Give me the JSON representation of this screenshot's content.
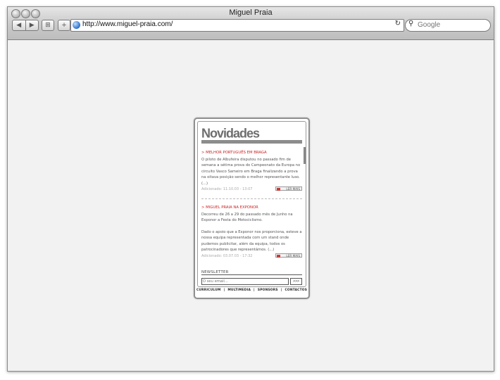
{
  "window": {
    "title": "Miguel Praia"
  },
  "toolbar": {
    "back_icon": "◀",
    "forward_icon": "▶",
    "bookmarks_icon": "⊞",
    "add_icon": "+",
    "url": "http://www.miguel-praia.com/",
    "reload_icon": "↻",
    "search_placeholder": "Google"
  },
  "widget": {
    "heading": "Novidades",
    "articles": [
      {
        "title": "> MELHOR PORTUGUÊS EM BRAGA",
        "body": "O piloto de Albufeira disputou no passado fim de semana a sétima prova do Campeonato da Europa no circuito Vasco Sameiro em Braga finalizando a prova na oitava posição sendo o melhor representante luso. (...)",
        "meta": "Adicionado: 11.10.03 - 13:07",
        "more": "LER MAIS"
      },
      {
        "title": "> MIGUEL PRAIA NA EXPONOR",
        "body": "Decorreu de 26 a 29 do passado mês de Junho na Exponor a Festa do Motociclismo.",
        "body2": "Dado o apoio que a Exponor nos proporciona, esteve a nossa equipa representada com um stand onde pudemos publicitar, além da equipa, todos os patrocinadores que representámos. (...)",
        "meta": "Adicionado: 03.07.03 - 17:32",
        "more": "LER MAIS"
      }
    ],
    "newsletter": {
      "title": "NEWSLETTER",
      "placeholder": "O seu email...",
      "button": ">>>"
    },
    "footer_nav": [
      "CURRICULUM",
      "MULTIMEDIA",
      "SPONSORS",
      "CONTACTOS"
    ],
    "separator": "|"
  }
}
